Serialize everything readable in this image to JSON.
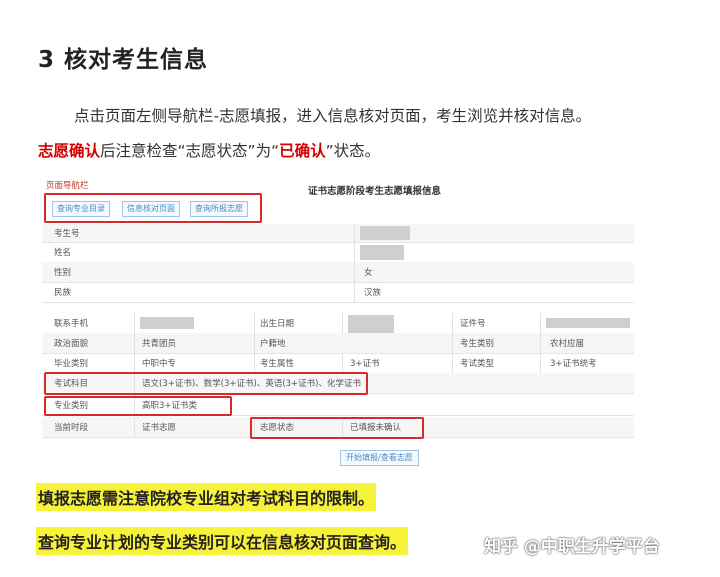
{
  "heading": "3  核对考生信息",
  "para1": "点击页面左侧导航栏-志愿填报，进入信息核对页面，考生浏览并核对信息。",
  "para2": {
    "red1": "志愿确认",
    "mid": "后注意检查“志愿状态”为“",
    "red2": "已确认",
    "end": "”状态。"
  },
  "screenshot": {
    "nav_title": "页面导航栏",
    "page_title": "证书志愿阶段考生志愿填报信息",
    "nav_buttons": [
      "查询专业目录",
      "信息核对页面",
      "查询所报志愿"
    ],
    "basic_rows": [
      {
        "label": "考生号",
        "value": ""
      },
      {
        "label": "姓名",
        "value": ""
      },
      {
        "label": "性别",
        "value": "女"
      },
      {
        "label": "民族",
        "value": "汉族"
      }
    ],
    "grid": {
      "r1": [
        "联系手机",
        "",
        "出生日期",
        "",
        "证件号",
        ""
      ],
      "r2": [
        "政治面貌",
        "共青团员",
        "户籍地",
        "",
        "考生类别",
        "农村应届"
      ],
      "r3": [
        "毕业类别",
        "中职中专",
        "考生属性",
        "3+证书",
        "考试类型",
        "3+证书统考"
      ]
    },
    "exam_subjects": {
      "label": "考试科目",
      "value": "语文(3+证书)、数学(3+证书)、英语(3+证书)、化学证书"
    },
    "major_category": {
      "label": "专业类别",
      "value": "高职3+证书类"
    },
    "stage_row": {
      "label": "当前时段",
      "value": "证书志愿",
      "status_label": "志愿状态",
      "status_value": "已填报未确认"
    },
    "submit_button": "开始填报/查看志愿"
  },
  "notes": [
    "填报志愿需注意院校专业组对考试科目的限制。",
    "查询专业计划的专业类别可以在信息核对页面查询。"
  ],
  "watermark": "知乎 @中职生升学平台",
  "colors": {
    "highlight_red": "#d62b2b",
    "note_yellow": "#f6f23a",
    "text_red": "#d40000"
  }
}
